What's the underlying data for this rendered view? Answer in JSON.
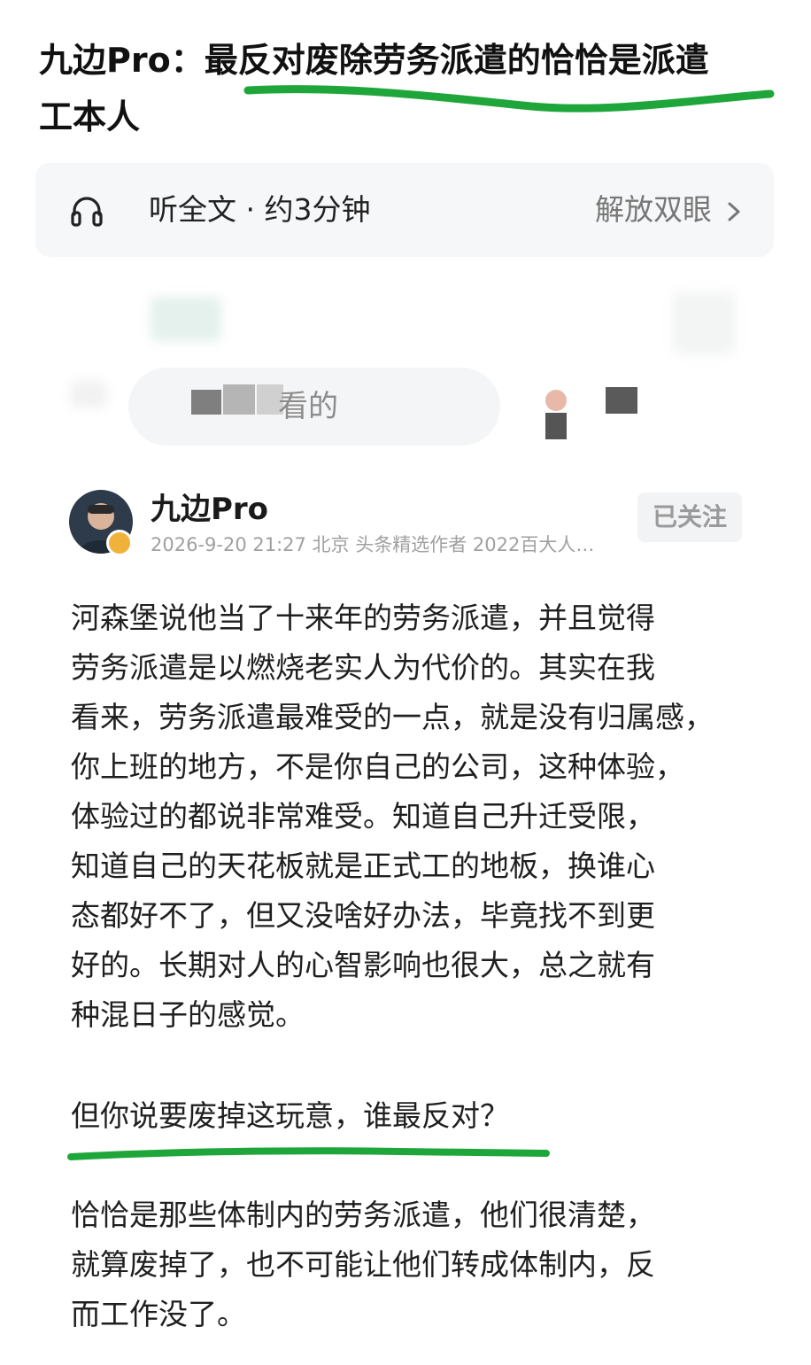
{
  "headline": {
    "line1": "九边Pro：最反对废除劳务派遣的恰恰是派遣",
    "line2": "工本人"
  },
  "listen_bar": {
    "icon": "headphones-icon",
    "text": "听全文 · 约3分钟",
    "action": "解放双眼",
    "action_icon": "chevron-right-icon"
  },
  "blurred_strip": {
    "visible_text": "看的"
  },
  "author": {
    "name": "九边Pro",
    "meta": "2026-9-20 21:27 北京 头条精选作者 2022百大人…",
    "follow_label": "已关注",
    "badge_color": "#f0b23a"
  },
  "article": {
    "paragraph1": [
      "河森堡说他当了十来年的劳务派遣，并且觉得",
      "劳务派遣是以燃烧老实人为代价的。其实在我",
      "看来，劳务派遣最难受的一点，就是没有归属感，",
      "你上班的地方，不是你自己的公司，这种体验，",
      "体验过的都说非常难受。知道自己升迁受限，",
      "知道自己的天花板就是正式工的地板，换谁心",
      "态都好不了，但又没啥好办法，毕竟找不到更",
      "好的。长期对人的心智影响也很大，总之就有",
      "种混日子的感觉。"
    ],
    "paragraph2": "但你说要废掉这玩意，谁最反对？",
    "paragraph3": [
      "恰恰是那些体制内的劳务派遣，他们很清楚，",
      "就算废掉了，也不可能让他们转成体制内，反",
      "而工作没了。"
    ]
  },
  "colors": {
    "highlight_stroke": "#1fa63a",
    "listen_bar_bg": "#f6f7f8"
  }
}
